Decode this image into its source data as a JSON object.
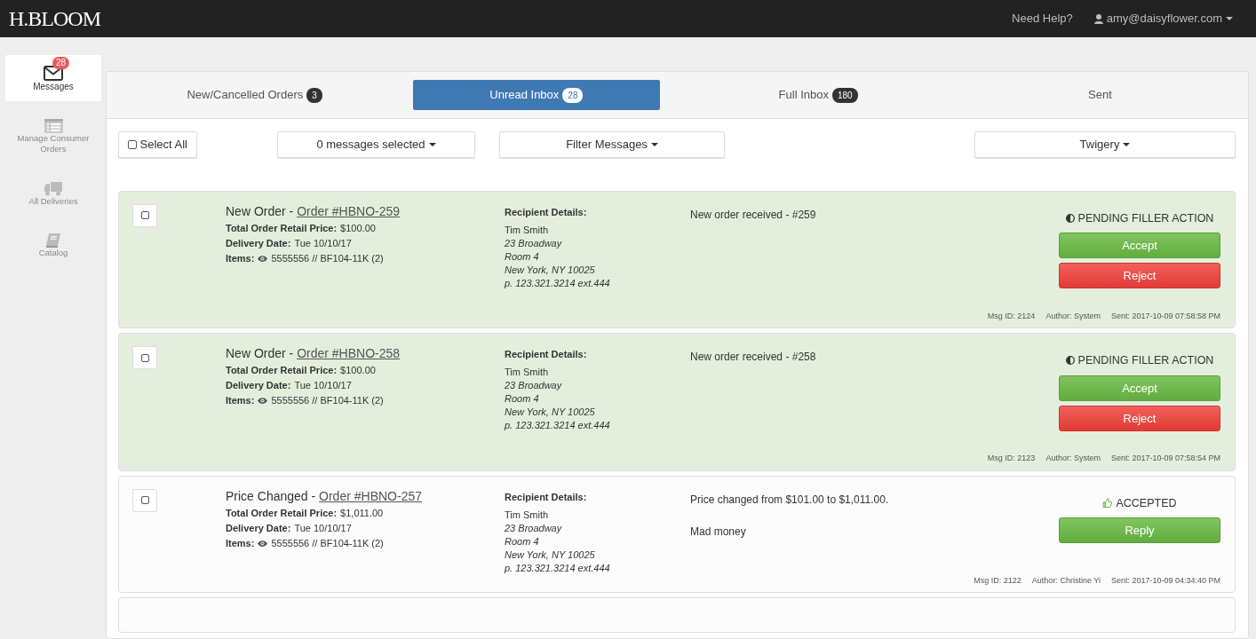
{
  "brand": "H.BLOOM",
  "topnav": {
    "help": "Need Help?",
    "user": "amy@daisyflower.com"
  },
  "sidebar": [
    {
      "label": "Messages",
      "badge": "28",
      "selected": true
    },
    {
      "label": "Manage Consumer Orders",
      "selected": false
    },
    {
      "label": "All Deliveries",
      "selected": false
    },
    {
      "label": "Catalog",
      "selected": false
    }
  ],
  "tabs": [
    {
      "label": "New/Cancelled Orders",
      "count": "3",
      "selected": false
    },
    {
      "label": "Unread Inbox",
      "count": "28",
      "selected": true
    },
    {
      "label": "Full Inbox",
      "count": "180",
      "selected": false
    },
    {
      "label": "Sent",
      "selected": false
    }
  ],
  "toolbar": {
    "select_all": {
      "label": "Select All",
      "checked": false
    },
    "selection": "0 messages selected",
    "filter": "Filter Messages",
    "store": "Twigery"
  },
  "messages": [
    {
      "unread": true,
      "checked": false,
      "type": "New Order - ",
      "order": "Order #HBNO-259",
      "price_label": "Total Order Retail Price:",
      "price": "$100.00",
      "date_label": "Delivery Date:",
      "date": "Tue 10/10/17",
      "items_label": "Items:",
      "items": "5555556 // BF104-11K (2)",
      "recipient_label": "Recipient Details:",
      "recipient_name": "Tim Smith",
      "address": [
        "23 Broadway",
        "Room 4",
        "New York, NY 10025",
        "p. 123.321.3214 ext.444"
      ],
      "body": [
        "New order received - #259"
      ],
      "status": {
        "kind": "pending",
        "label": "PENDING FILLER ACTION"
      },
      "actions": [
        {
          "kind": "accept",
          "label": "Accept"
        },
        {
          "kind": "reject",
          "label": "Reject"
        }
      ],
      "msg_id": "Msg ID: 2124",
      "author": "Author: System",
      "sent": "Sent: 2017-10-09 07:58:58 PM"
    },
    {
      "unread": true,
      "checked": false,
      "type": "New Order - ",
      "order": "Order #HBNO-258",
      "price_label": "Total Order Retail Price:",
      "price": "$100.00",
      "date_label": "Delivery Date:",
      "date": "Tue 10/10/17",
      "items_label": "Items:",
      "items": "5555556 // BF104-11K (2)",
      "recipient_label": "Recipient Details:",
      "recipient_name": "Tim Smith",
      "address": [
        "23 Broadway",
        "Room 4",
        "New York, NY 10025",
        "p. 123.321.3214 ext.444"
      ],
      "body": [
        "New order received - #258"
      ],
      "status": {
        "kind": "pending",
        "label": "PENDING FILLER ACTION"
      },
      "actions": [
        {
          "kind": "accept",
          "label": "Accept"
        },
        {
          "kind": "reject",
          "label": "Reject"
        }
      ],
      "msg_id": "Msg ID: 2123",
      "author": "Author: System",
      "sent": "Sent: 2017-10-09 07:58:54 PM"
    },
    {
      "unread": false,
      "checked": false,
      "type": "Price Changed - ",
      "order": "Order #HBNO-257",
      "price_label": "Total Order Retail Price:",
      "price": "$1,011.00",
      "date_label": "Delivery Date:",
      "date": "Tue 10/10/17",
      "items_label": "Items:",
      "items": "5555556 // BF104-11K (2)",
      "recipient_label": "Recipient Details:",
      "recipient_name": "Tim Smith",
      "address": [
        "23 Broadway",
        "Room 4",
        "New York, NY 10025",
        "p. 123.321.3214 ext.444"
      ],
      "body": [
        "Price changed from $101.00 to $1,011.00.",
        "Mad money"
      ],
      "status": {
        "kind": "accepted",
        "label": "ACCEPTED"
      },
      "actions": [
        {
          "kind": "reply",
          "label": "Reply"
        }
      ],
      "msg_id": "Msg ID: 2122",
      "author": "Author: Christine Yi",
      "sent": "Sent: 2017-10-09 04:34:40 PM"
    },
    {
      "unread": false,
      "partial": true
    }
  ]
}
